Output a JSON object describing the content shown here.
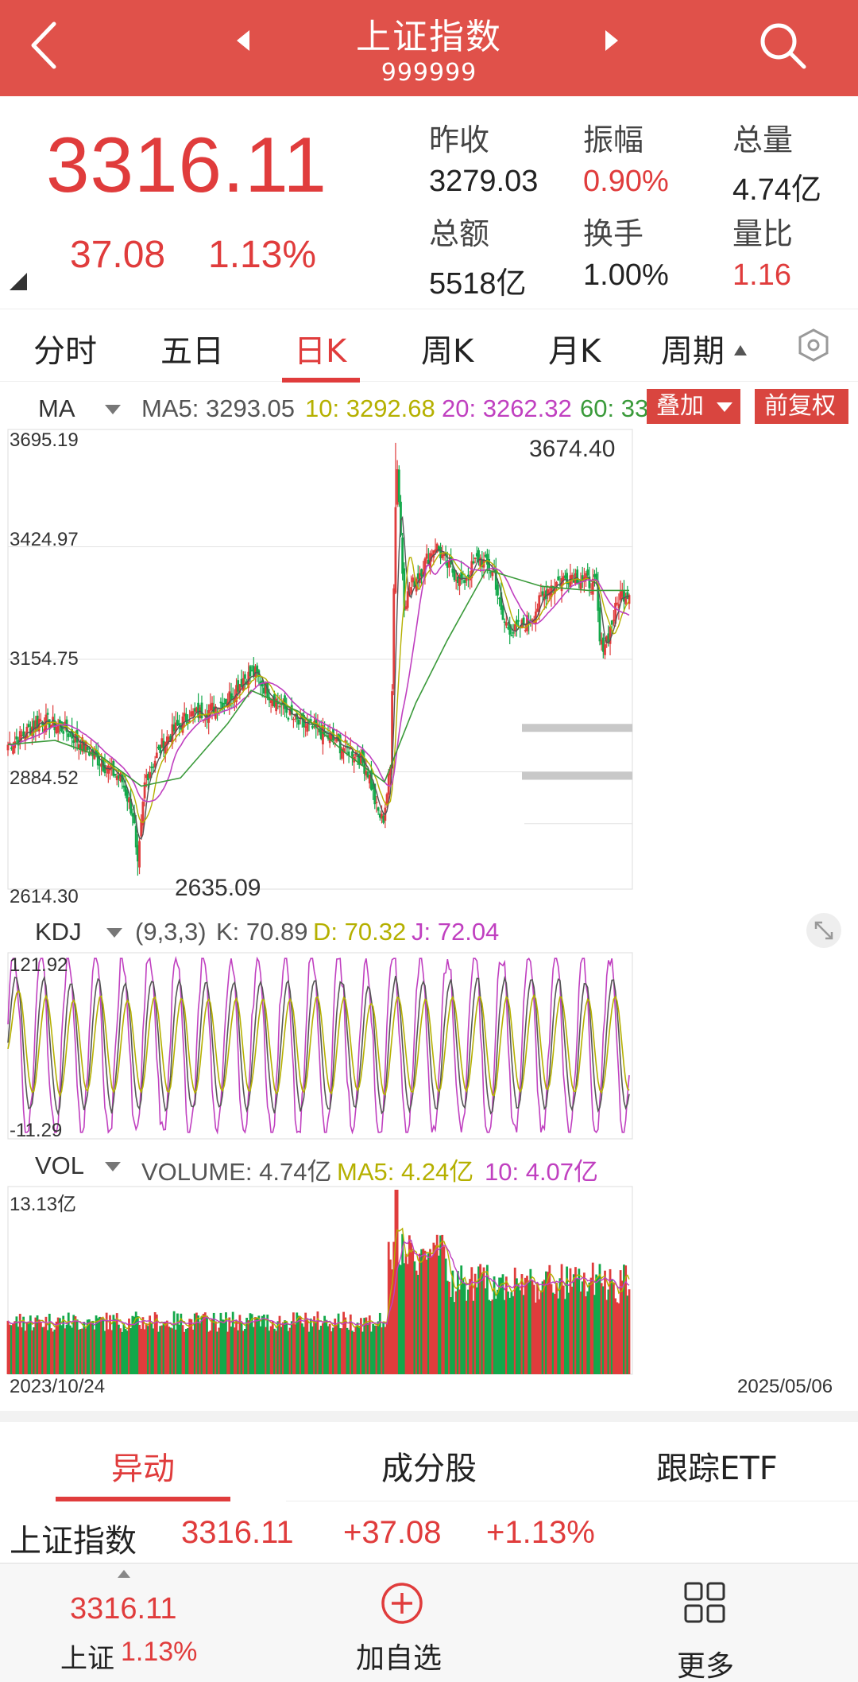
{
  "header": {
    "title": "上证指数",
    "code": "999999"
  },
  "quote": {
    "price": "3316.11",
    "change": "37.08",
    "change_pct": "1.13%",
    "stats": [
      {
        "label": "昨收",
        "value": "3279.03",
        "red": false
      },
      {
        "label": "振幅",
        "value": "0.90%",
        "red": true
      },
      {
        "label": "总量",
        "value": "4.74亿",
        "red": false
      },
      {
        "label": "总额",
        "value": "5518亿",
        "red": false
      },
      {
        "label": "换手",
        "value": "1.00%",
        "red": false
      },
      {
        "label": "量比",
        "value": "1.16",
        "red": true
      }
    ]
  },
  "period_tabs": [
    "分时",
    "五日",
    "日K",
    "周K",
    "月K",
    "周期"
  ],
  "active_period": "日K",
  "ma_bar": {
    "name": "MA",
    "ma5": "MA5: 3293.05",
    "ma10": "10: 3292.68",
    "ma20": "20: 3262.32",
    "ma60": "60: 33",
    "overlay": "叠加",
    "adjust": "前复权"
  },
  "kdj_bar": {
    "name": "KDJ",
    "params": "(9,3,3)",
    "k": "K: 70.89",
    "d": "D: 70.32",
    "j": "J: 72.04"
  },
  "vol_bar": {
    "name": "VOL",
    "volume": "VOLUME: 4.74亿",
    "ma5": "MA5: 4.24亿",
    "ma10": "10: 4.07亿"
  },
  "colors": {
    "header": "#e0514a",
    "up": "#e03c3c",
    "down": "#13a84a",
    "ma5": "#555555",
    "ma10": "#b5b000",
    "ma20": "#c040c0",
    "ma60": "#3a9a3a"
  },
  "chart_data": [
    {
      "type": "candlestick",
      "y_axis_labels": [
        "3695.19",
        "3424.97",
        "3154.75",
        "2884.52",
        "2614.30"
      ],
      "ylim": [
        2614.3,
        3695.19
      ],
      "x_start": "2023/10/24",
      "x_end": "2025/05/06",
      "annotations": [
        {
          "label": "3674.40",
          "value": 3674.4
        },
        {
          "label": "2635.09",
          "value": 2635.09
        }
      ],
      "close_path": [
        [
          0,
          2950
        ],
        [
          18,
          2970
        ],
        [
          40,
          3010
        ],
        [
          70,
          2990
        ],
        [
          95,
          2950
        ],
        [
          120,
          2905
        ],
        [
          145,
          2865
        ],
        [
          160,
          2780
        ],
        [
          165,
          2640
        ],
        [
          175,
          2870
        ],
        [
          200,
          2960
        ],
        [
          230,
          3020
        ],
        [
          255,
          3030
        ],
        [
          280,
          3060
        ],
        [
          300,
          3110
        ],
        [
          315,
          3120
        ],
        [
          330,
          3080
        ],
        [
          350,
          3040
        ],
        [
          370,
          3000
        ],
        [
          400,
          2980
        ],
        [
          425,
          2945
        ],
        [
          445,
          2930
        ],
        [
          460,
          2880
        ],
        [
          470,
          2795
        ],
        [
          478,
          2765
        ],
        [
          488,
          2900
        ],
        [
          495,
          3674
        ],
        [
          505,
          3290
        ],
        [
          520,
          3350
        ],
        [
          545,
          3430
        ],
        [
          560,
          3380
        ],
        [
          580,
          3340
        ],
        [
          600,
          3400
        ],
        [
          620,
          3360
        ],
        [
          630,
          3250
        ],
        [
          645,
          3220
        ],
        [
          665,
          3250
        ],
        [
          690,
          3330
        ],
        [
          720,
          3360
        ],
        [
          750,
          3330
        ],
        [
          755,
          3180
        ],
        [
          765,
          3210
        ],
        [
          780,
          3310
        ],
        [
          792,
          3316
        ]
      ],
      "ma60_path": [
        [
          0,
          2950
        ],
        [
          60,
          2960
        ],
        [
          120,
          2920
        ],
        [
          170,
          2850
        ],
        [
          220,
          2870
        ],
        [
          280,
          3000
        ],
        [
          310,
          3080
        ],
        [
          370,
          3030
        ],
        [
          430,
          2930
        ],
        [
          480,
          2860
        ],
        [
          520,
          3050
        ],
        [
          560,
          3200
        ],
        [
          610,
          3370
        ],
        [
          680,
          3330
        ],
        [
          740,
          3320
        ],
        [
          792,
          3320
        ]
      ]
    },
    {
      "type": "line",
      "title": "KDJ",
      "ylim": [
        -11.29,
        121.92
      ],
      "y_axis_labels": [
        "121.92",
        "-11.29"
      ],
      "series": [
        {
          "name": "K"
        },
        {
          "name": "D"
        },
        {
          "name": "J"
        }
      ]
    },
    {
      "type": "bar",
      "title": "VOL",
      "y_axis_labels": [
        "13.13亿"
      ],
      "ylim": [
        0,
        13.13
      ]
    }
  ],
  "bottom_tabs": [
    "异动",
    "成分股",
    "跟踪ETF"
  ],
  "index_row": {
    "name": "上证指数",
    "price": "3316.11",
    "change": "+37.08",
    "pct": "+1.13%"
  },
  "bottom_bar": {
    "price": "3316.11",
    "name": "上证",
    "pct": "1.13%",
    "add": "加自选",
    "more": "更多"
  }
}
